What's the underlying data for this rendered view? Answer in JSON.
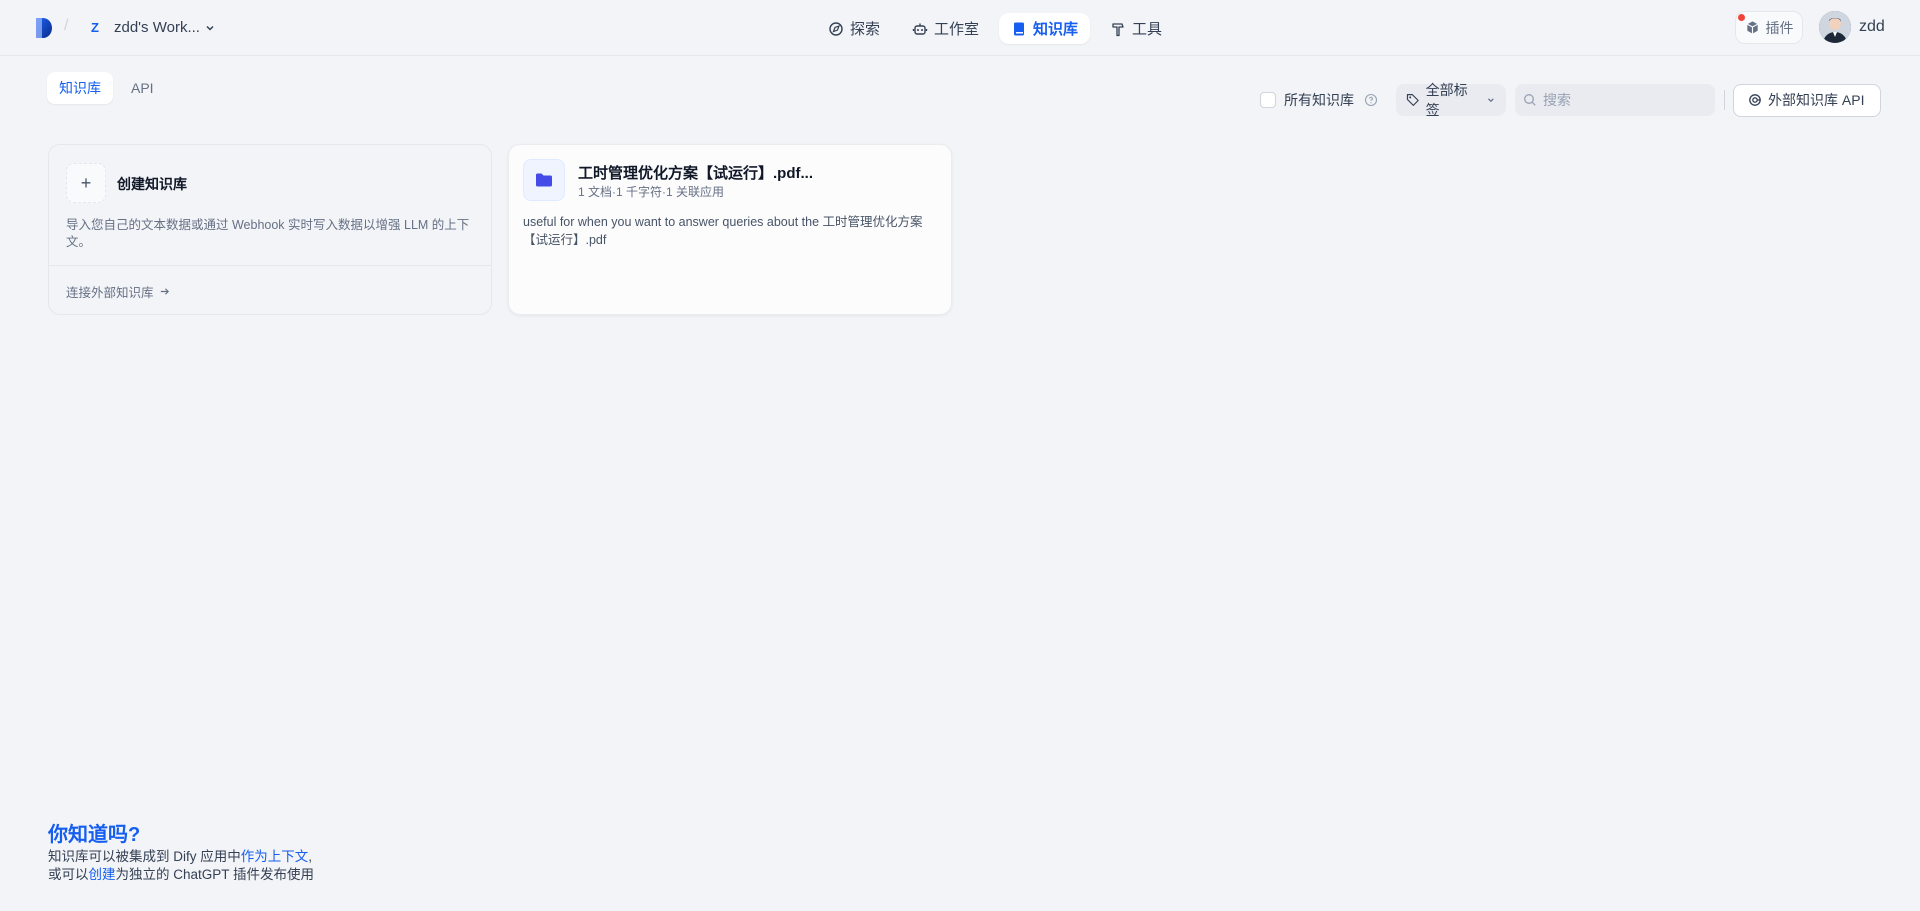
{
  "header": {
    "workspace_initial": "Z",
    "workspace_name": "zdd's Work...",
    "nav": [
      {
        "label": "探索",
        "icon": "compass-icon"
      },
      {
        "label": "工作室",
        "icon": "robot-icon"
      },
      {
        "label": "知识库",
        "icon": "book-icon",
        "active": true
      },
      {
        "label": "工具",
        "icon": "hammer-icon"
      }
    ],
    "plugin_label": "插件",
    "user_name": "zdd"
  },
  "tabs": [
    {
      "label": "知识库",
      "active": true
    },
    {
      "label": "API",
      "active": false
    }
  ],
  "toolbar": {
    "all_kb_label": "所有知识库",
    "tag_filter_label": "全部标签",
    "search_placeholder": "搜索",
    "external_api_label": "外部知识库 API"
  },
  "create_card": {
    "title": "创建知识库",
    "description": "导入您自己的文本数据或通过 Webhook 实时写入数据以增强 LLM 的上下文。",
    "link": "连接外部知识库"
  },
  "datasets": [
    {
      "title": "工时管理优化方案【试运行】.pdf...",
      "meta": "1 文档·1 千字符·1 关联应用",
      "description": "useful for when you want to answer queries about the 工时管理优化方案【试运行】.pdf"
    }
  ],
  "tip": {
    "title": "你知道吗?",
    "line1_prefix": "知识库可以被集成到 Dify 应用中",
    "line1_link": "作为上下文",
    "line1_suffix": ",",
    "line2_prefix": "或可以",
    "line2_link": "创建",
    "line2_suffix": "为独立的 ChatGPT 插件发布使用"
  },
  "colors": {
    "accent": "#155eef",
    "background": "#f2f4f7",
    "notification": "#f04438"
  }
}
